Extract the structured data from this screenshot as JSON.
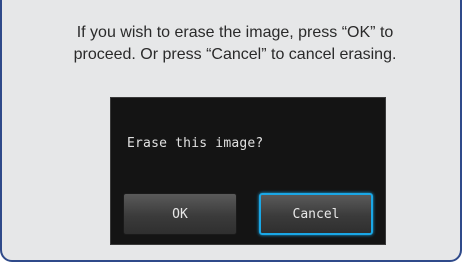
{
  "instructions": {
    "line1": "If you wish to erase the image, press “OK” to",
    "line2": "proceed. Or press “Cancel” to cancel erasing."
  },
  "dialog": {
    "prompt": "Erase this image?",
    "ok_label": "OK",
    "cancel_label": "Cancel",
    "focused_button": "Cancel"
  },
  "colors": {
    "frame_border": "#2f4a8a",
    "frame_background": "#e6e7e8",
    "screen_background": "#141414",
    "focus_highlight": "#1aa7e6"
  }
}
